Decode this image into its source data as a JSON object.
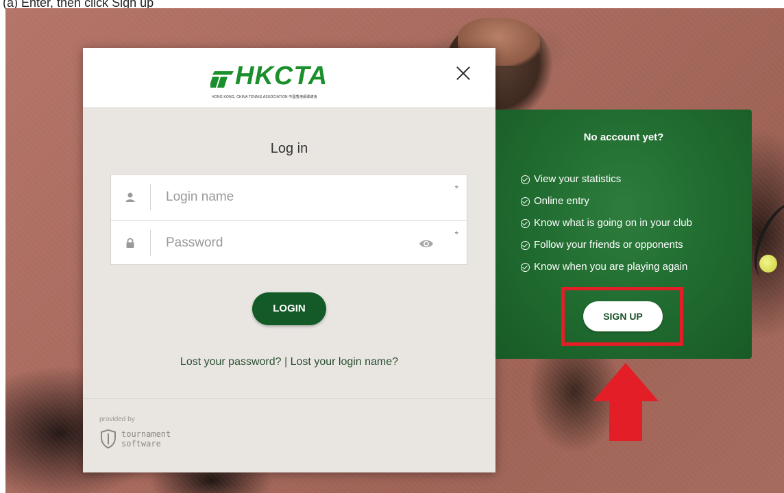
{
  "caption": "(a) Enter, then click Sign up",
  "brand": {
    "logo_text": "HKCTA",
    "logo_subtitle": "HONG KONG, CHINA TENNIS ASSOCIATION 中國香港網球總會",
    "color": "#1a8f2b"
  },
  "login": {
    "title": "Log in",
    "login_name_placeholder": "Login name",
    "password_placeholder": "Password",
    "required_mark": "*",
    "login_button": "LOGIN",
    "lost_password": "Lost your password?",
    "separator": "|",
    "lost_login_name": "Lost your login name?"
  },
  "footer": {
    "provided_by": "provided by",
    "brand_line1": "tournament",
    "brand_line2": "software"
  },
  "signup": {
    "title": "No account yet?",
    "benefits": [
      "View your statistics",
      "Online entry",
      "Know what is going on in your club",
      "Follow your friends or opponents",
      "Know when you are playing again"
    ],
    "button": "SIGN UP",
    "panel_color": "#1f6a2f"
  },
  "annotation": {
    "highlight_color": "#e31e27"
  }
}
